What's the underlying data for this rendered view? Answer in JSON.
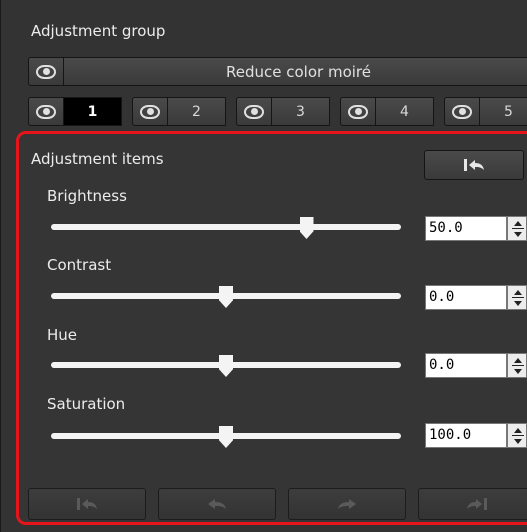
{
  "adjustment_group": {
    "label": "Adjustment group",
    "reduce_button": "Reduce color moiré"
  },
  "tabs": [
    {
      "label": "1",
      "active": true
    },
    {
      "label": "2",
      "active": false
    },
    {
      "label": "3",
      "active": false
    },
    {
      "label": "4",
      "active": false
    },
    {
      "label": "5",
      "active": false
    }
  ],
  "adjustment_items": {
    "label": "Adjustment items",
    "reset_icon": "undo-to-start-icon",
    "sliders": [
      {
        "label": "Brightness",
        "value": "50.0",
        "position": 0.73
      },
      {
        "label": "Contrast",
        "value": "0.0",
        "position": 0.5
      },
      {
        "label": "Hue",
        "value": "0.0",
        "position": 0.5
      },
      {
        "label": "Saturation",
        "value": "100.0",
        "position": 0.5
      }
    ]
  },
  "bottom_buttons": [
    {
      "icon": "first-step-icon",
      "enabled": false
    },
    {
      "icon": "undo-icon",
      "enabled": false
    },
    {
      "icon": "redo-icon",
      "enabled": false
    },
    {
      "icon": "last-step-icon",
      "enabled": false
    }
  ],
  "colors": {
    "highlight": "#e8141c",
    "panel": "#333333"
  }
}
